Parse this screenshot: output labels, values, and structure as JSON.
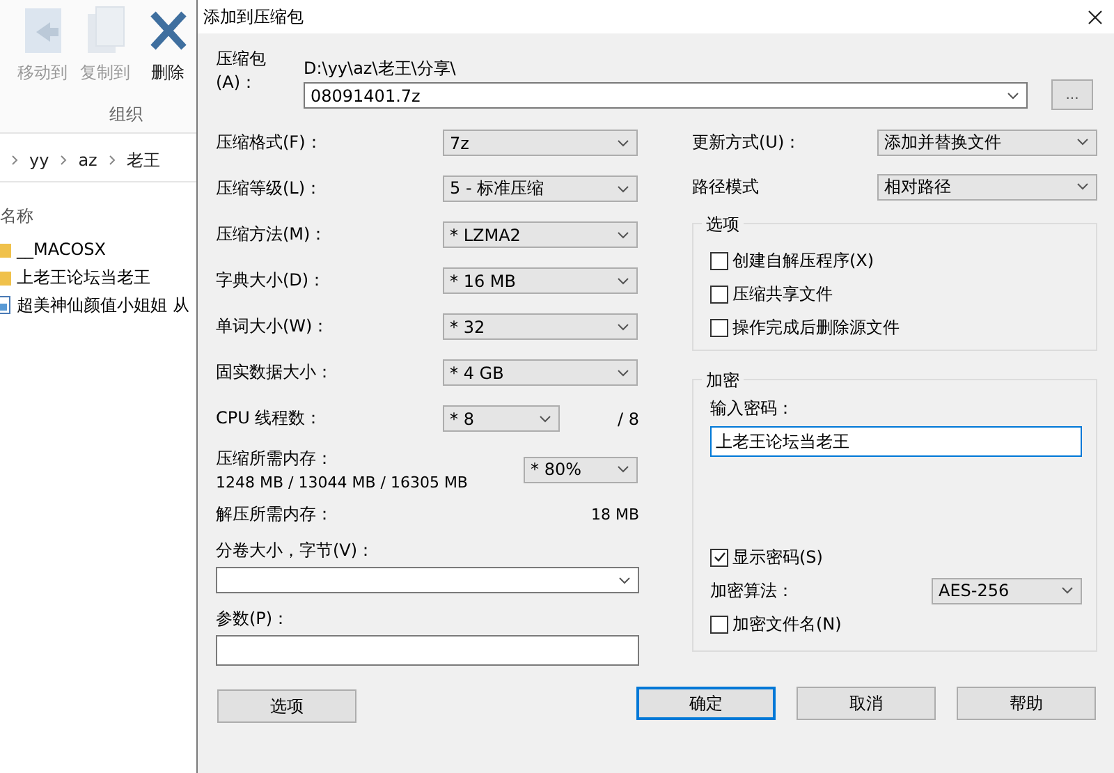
{
  "explorer": {
    "ribbon_buttons": [
      {
        "label": "移动到",
        "kind": "move",
        "disabled": true
      },
      {
        "label": "复制到",
        "kind": "copy",
        "disabled": true
      },
      {
        "label": "删除",
        "kind": "delete",
        "disabled": false
      }
    ],
    "ribbon_group": "组织",
    "breadcrumb": [
      "yy",
      "az",
      "老王"
    ],
    "column_header": "名称",
    "files": [
      {
        "name": "__MACOSX",
        "kind": "folder"
      },
      {
        "name": "上老王论坛当老王",
        "kind": "folder"
      },
      {
        "name": "超美神仙颜值小姐姐 从",
        "kind": "image"
      }
    ]
  },
  "dialog": {
    "title": "添加到压缩包",
    "archive": {
      "label": "压缩包(A)：",
      "path": "D:\\yy\\az\\老王\\分享\\",
      "value": "08091401.7z"
    },
    "browse_button": "...",
    "settings": [
      {
        "label": "压缩格式(F)：",
        "value": "7z"
      },
      {
        "label": "压缩等级(L)：",
        "value": "5 - 标准压缩"
      },
      {
        "label": "压缩方法(M)：",
        "value": "* LZMA2"
      },
      {
        "label": "字典大小(D)：",
        "value": "* 16 MB"
      },
      {
        "label": "单词大小(W)：",
        "value": "* 32"
      },
      {
        "label": "固实数据大小：",
        "value": "* 4 GB"
      }
    ],
    "cpu": {
      "label": "CPU 线程数：",
      "value": "* 8",
      "max": "/ 8"
    },
    "memory": {
      "label": "压缩所需内存：",
      "value": "1248 MB / 13044 MB / 16305 MB",
      "limit": "* 80%"
    },
    "decompress_memory": {
      "label": "解压所需内存：",
      "value": "18 MB"
    },
    "volume": {
      "label": "分卷大小，字节(V)："
    },
    "parameters": {
      "label": "参数(P)："
    },
    "options_button": "选项",
    "update_mode": {
      "label": "更新方式(U)：",
      "value": "添加并替换文件"
    },
    "path_mode": {
      "label": "路径模式",
      "value": "相对路径"
    },
    "options_group": {
      "title": "选项",
      "checkboxes": [
        {
          "label": "创建自解压程序(X)",
          "checked": false
        },
        {
          "label": "压缩共享文件",
          "checked": false
        },
        {
          "label": "操作完成后删除源文件",
          "checked": false
        }
      ]
    },
    "encryption": {
      "title": "加密",
      "password_label": "输入密码：",
      "password": "上老王论坛当老王",
      "show_password": {
        "label": "显示密码(S)",
        "checked": true
      },
      "method": {
        "label": "加密算法：",
        "value": "AES-256"
      },
      "encrypt_names": {
        "label": "加密文件名(N)",
        "checked": false
      }
    },
    "buttons": [
      {
        "label": "确定",
        "default": true
      },
      {
        "label": "取消",
        "default": false
      },
      {
        "label": "帮助",
        "default": false
      }
    ]
  }
}
